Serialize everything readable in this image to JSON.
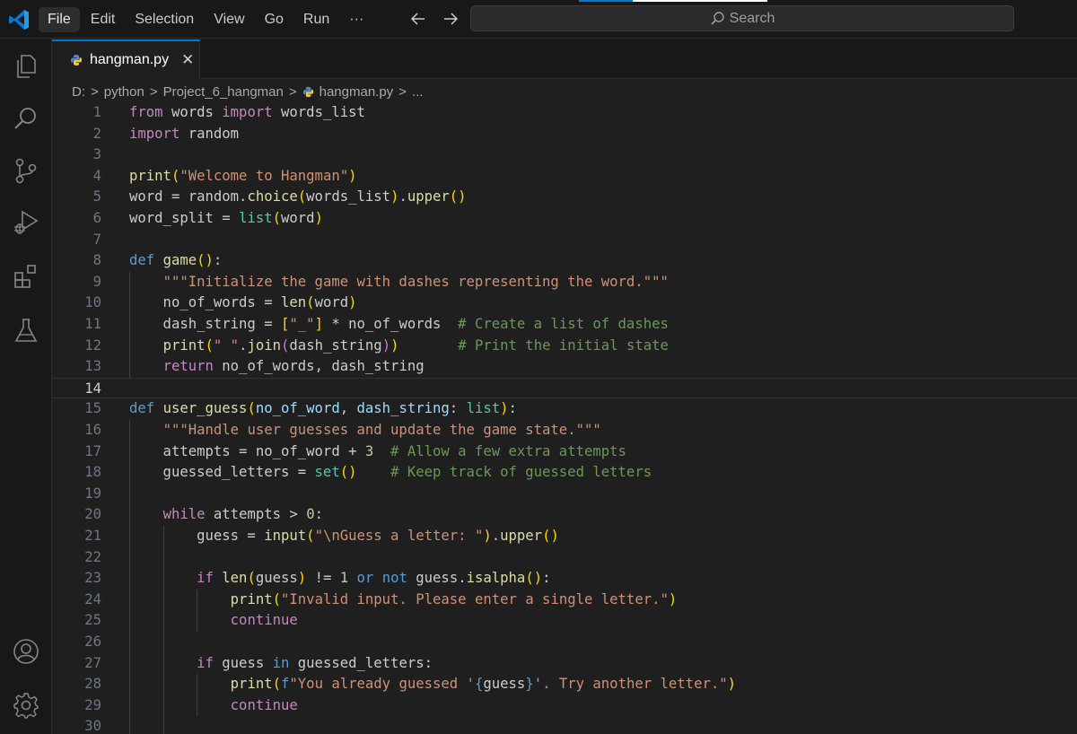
{
  "menu": [
    "File",
    "Edit",
    "Selection",
    "View",
    "Go",
    "Run",
    "···"
  ],
  "search": {
    "label": "Search"
  },
  "tab": {
    "name": "hangman.py",
    "close": "✕"
  },
  "breadcrumb": {
    "drive": "D:",
    "folder1": "python",
    "folder2": "Project_6_hangman",
    "file": "hangman.py",
    "more": "..."
  },
  "colors": {
    "accent": "#0078d4",
    "editor_bg": "#1f1f1f",
    "sidebar_bg": "#181818"
  },
  "icons": [
    "vscode-logo-icon",
    "explorer-icon",
    "search-icon",
    "source-control-icon",
    "run-debug-icon",
    "extensions-icon",
    "testing-icon",
    "account-icon",
    "settings-gear-icon"
  ],
  "editor": {
    "current_line": 14,
    "lines": [
      {
        "n": "1",
        "t": [
          [
            "kw",
            "from"
          ],
          [
            "p",
            " words "
          ],
          [
            "kw",
            "import"
          ],
          [
            "p",
            " words_list"
          ]
        ]
      },
      {
        "n": "2",
        "t": [
          [
            "kw",
            "import"
          ],
          [
            "p",
            " random"
          ]
        ]
      },
      {
        "n": "3",
        "t": []
      },
      {
        "n": "4",
        "t": [
          [
            "fn",
            "print"
          ],
          [
            "b1",
            "("
          ],
          [
            "str",
            "\"Welcome to Hangman\""
          ],
          [
            "b1",
            ")"
          ]
        ]
      },
      {
        "n": "5",
        "t": [
          [
            "p",
            "word = random."
          ],
          [
            "fn",
            "choice"
          ],
          [
            "b1",
            "("
          ],
          [
            "p",
            "words_list"
          ],
          [
            "b1",
            ")"
          ],
          [
            "p",
            "."
          ],
          [
            "fn",
            "upper"
          ],
          [
            "b1",
            "()"
          ]
        ]
      },
      {
        "n": "6",
        "t": [
          [
            "p",
            "word_split = "
          ],
          [
            "cls",
            "list"
          ],
          [
            "b1",
            "("
          ],
          [
            "p",
            "word"
          ],
          [
            "b1",
            ")"
          ]
        ]
      },
      {
        "n": "7",
        "t": []
      },
      {
        "n": "8",
        "t": [
          [
            "st",
            "def"
          ],
          [
            "p",
            " "
          ],
          [
            "fn",
            "game"
          ],
          [
            "b1",
            "()"
          ],
          [
            "p",
            ":"
          ]
        ]
      },
      {
        "n": "9",
        "t": [
          [
            "p",
            "    "
          ],
          [
            "str",
            "\"\"\"Initialize the game with dashes representing the word.\"\"\""
          ]
        ]
      },
      {
        "n": "10",
        "t": [
          [
            "p",
            "    no_of_words = "
          ],
          [
            "fn",
            "len"
          ],
          [
            "b1",
            "("
          ],
          [
            "p",
            "word"
          ],
          [
            "b1",
            ")"
          ]
        ]
      },
      {
        "n": "11",
        "t": [
          [
            "p",
            "    dash_string = "
          ],
          [
            "b1",
            "["
          ],
          [
            "str",
            "\"_\""
          ],
          [
            "b1",
            "]"
          ],
          [
            "p",
            " * no_of_words  "
          ],
          [
            "cm",
            "# Create a list of dashes"
          ]
        ]
      },
      {
        "n": "12",
        "t": [
          [
            "p",
            "    "
          ],
          [
            "fn",
            "print"
          ],
          [
            "b1",
            "("
          ],
          [
            "str",
            "\" \""
          ],
          [
            "p",
            "."
          ],
          [
            "fn",
            "join"
          ],
          [
            "b2",
            "("
          ],
          [
            "p",
            "dash_string"
          ],
          [
            "b2",
            ")"
          ],
          [
            "b1",
            ")"
          ],
          [
            "p",
            "       "
          ],
          [
            "cm",
            "# Print the initial state"
          ]
        ]
      },
      {
        "n": "13",
        "t": [
          [
            "p",
            "    "
          ],
          [
            "kw",
            "return"
          ],
          [
            "p",
            " no_of_words, dash_string"
          ]
        ]
      },
      {
        "n": "14",
        "t": []
      },
      {
        "n": "15",
        "t": [
          [
            "st",
            "def"
          ],
          [
            "p",
            " "
          ],
          [
            "fn",
            "user_guess"
          ],
          [
            "b1",
            "("
          ],
          [
            "var",
            "no_of_word"
          ],
          [
            "p",
            ", "
          ],
          [
            "var",
            "dash_string"
          ],
          [
            "p",
            ": "
          ],
          [
            "cls",
            "list"
          ],
          [
            "b1",
            ")"
          ],
          [
            "p",
            ":"
          ]
        ]
      },
      {
        "n": "16",
        "t": [
          [
            "p",
            "    "
          ],
          [
            "str",
            "\"\"\"Handle user guesses and update the game state.\"\"\""
          ]
        ]
      },
      {
        "n": "17",
        "t": [
          [
            "p",
            "    attempts = no_of_word + "
          ],
          [
            "num",
            "3"
          ],
          [
            "p",
            "  "
          ],
          [
            "cm",
            "# Allow a few extra attempts"
          ]
        ]
      },
      {
        "n": "18",
        "t": [
          [
            "p",
            "    guessed_letters = "
          ],
          [
            "cls",
            "set"
          ],
          [
            "b1",
            "()"
          ],
          [
            "p",
            "    "
          ],
          [
            "cm",
            "# Keep track of guessed letters"
          ]
        ]
      },
      {
        "n": "19",
        "t": []
      },
      {
        "n": "20",
        "t": [
          [
            "p",
            "    "
          ],
          [
            "kw",
            "while"
          ],
          [
            "p",
            " attempts > "
          ],
          [
            "num",
            "0"
          ],
          [
            "p",
            ":"
          ]
        ]
      },
      {
        "n": "21",
        "t": [
          [
            "p",
            "        guess = "
          ],
          [
            "fn",
            "input"
          ],
          [
            "b1",
            "("
          ],
          [
            "str",
            "\"\\nGuess a letter: \""
          ],
          [
            "b1",
            ")"
          ],
          [
            "p",
            "."
          ],
          [
            "fn",
            "upper"
          ],
          [
            "b1",
            "()"
          ]
        ]
      },
      {
        "n": "22",
        "t": []
      },
      {
        "n": "23",
        "t": [
          [
            "p",
            "        "
          ],
          [
            "kw",
            "if"
          ],
          [
            "p",
            " "
          ],
          [
            "fn",
            "len"
          ],
          [
            "b1",
            "("
          ],
          [
            "p",
            "guess"
          ],
          [
            "b1",
            ")"
          ],
          [
            "p",
            " != "
          ],
          [
            "num",
            "1"
          ],
          [
            "p",
            " "
          ],
          [
            "st",
            "or"
          ],
          [
            "p",
            " "
          ],
          [
            "st",
            "not"
          ],
          [
            "p",
            " guess."
          ],
          [
            "fn",
            "isalpha"
          ],
          [
            "b1",
            "()"
          ],
          [
            "p",
            ":"
          ]
        ]
      },
      {
        "n": "24",
        "t": [
          [
            "p",
            "            "
          ],
          [
            "fn",
            "print"
          ],
          [
            "b1",
            "("
          ],
          [
            "str",
            "\"Invalid input. Please enter a single letter.\""
          ],
          [
            "b1",
            ")"
          ]
        ]
      },
      {
        "n": "25",
        "t": [
          [
            "p",
            "            "
          ],
          [
            "kw",
            "continue"
          ]
        ]
      },
      {
        "n": "26",
        "t": []
      },
      {
        "n": "27",
        "t": [
          [
            "p",
            "        "
          ],
          [
            "kw",
            "if"
          ],
          [
            "p",
            " guess "
          ],
          [
            "st",
            "in"
          ],
          [
            "p",
            " guessed_letters:"
          ]
        ]
      },
      {
        "n": "28",
        "t": [
          [
            "p",
            "            "
          ],
          [
            "fn",
            "print"
          ],
          [
            "b1",
            "("
          ],
          [
            "st",
            "f"
          ],
          [
            "str",
            "\"You already guessed '"
          ],
          [
            "st",
            "{"
          ],
          [
            "p",
            "guess"
          ],
          [
            "st",
            "}"
          ],
          [
            "str",
            "'. Try another letter.\""
          ],
          [
            "b1",
            ")"
          ]
        ]
      },
      {
        "n": "29",
        "t": [
          [
            "p",
            "            "
          ],
          [
            "kw",
            "continue"
          ]
        ]
      },
      {
        "n": "30",
        "t": []
      }
    ]
  }
}
